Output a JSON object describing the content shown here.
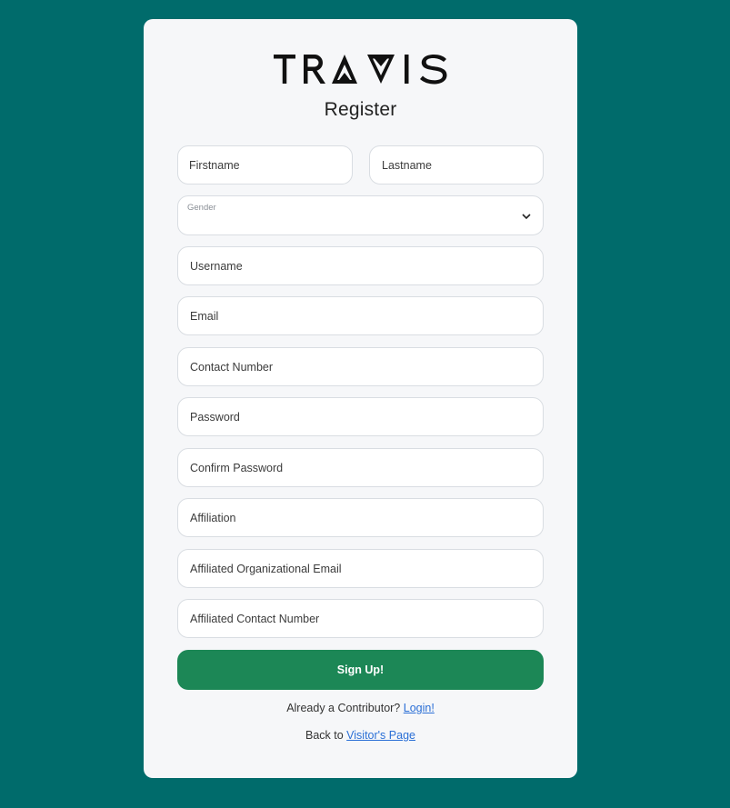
{
  "brand": {
    "logo_text": "TRAVIS"
  },
  "form": {
    "title": "Register",
    "firstname_placeholder": "Firstname",
    "lastname_placeholder": "Lastname",
    "gender_label": "Gender",
    "gender_value": "",
    "username_placeholder": "Username",
    "email_placeholder": "Email",
    "contact_placeholder": "Contact Number",
    "password_placeholder": "Password",
    "confirm_password_placeholder": "Confirm Password",
    "affiliation_placeholder": "Affiliation",
    "affiliated_email_placeholder": "Affiliated Organizational Email",
    "affiliated_contact_placeholder": "Affiliated Contact Number",
    "submit_label": "Sign Up!"
  },
  "footer": {
    "contributor_text": "Already a Contributor?",
    "login_link": "Login!",
    "back_text": "Back to",
    "visitor_link": "Visitor's Page"
  },
  "colors": {
    "background": "#006b6b",
    "card": "#f6f7f9",
    "button": "#1c8756",
    "link": "#2a6fd6"
  },
  "icons": {
    "gender_dropdown": "chevron-down-icon"
  }
}
